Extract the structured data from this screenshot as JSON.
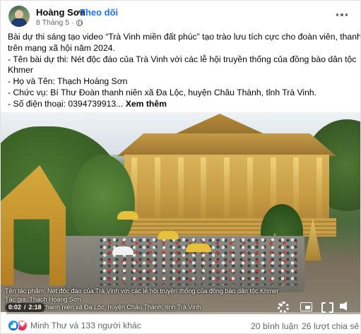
{
  "post": {
    "author": "Hoàng Sơn",
    "separator": "·",
    "follow_label": "Theo dõi",
    "date": "8 Tháng 5",
    "meta_separator": "·",
    "privacy_icon": "globe-icon",
    "more_icon": "more-options-icon",
    "text_lines": [
      "Bài dự thi sáng tạo video “Trà Vinh miền đất phúc” tạo trào lưu tích cực cho đoàn viên, thanh niên",
      "trên mạng xã hội năm 2024.",
      "- Tên bài dự thi: Nét độc đáo của Trà Vinh với các lễ hội truyền thống của đồng bào dân tộc",
      "Khmer",
      "- Họ và Tên: Thạch Hoàng Sơn",
      "- Chức vụ: Bí Thư Đoàn thanh niên xã Đa Lộc, huyện Châu Thành, tỉnh Trà Vinh.",
      "- Số điện thoại: 0394739913..."
    ],
    "see_more_label": "Xem thêm"
  },
  "video": {
    "caption_lines": [
      "Tên tác phẩm: Nét độc đáo của Trà Vinh với các lễ hội truyền thống của đồng bào dân tộc Khmer",
      "Tác giả: Thạch Hoàng Sơn",
      "Đơn vị: Đoàn thanh niên xã Đa Lộc, huyện Châu Thành, tỉnh Trà Vinh"
    ],
    "current_time": "0:02",
    "time_separator": "/",
    "duration": "2:18",
    "progress": 0.015,
    "controls": {
      "settings_icon": "gear-icon",
      "pip_icon": "picture-in-picture-icon",
      "fullscreen_icon": "fullscreen-icon",
      "volume_icon": "volume-icon"
    }
  },
  "footer": {
    "reactions_text": "Minh Thư và 133 người khác",
    "comments": "20 bình luận",
    "shares": "26 lượt chia sẻ",
    "like_icon": "like-icon",
    "heart_icon": "heart-icon"
  },
  "colors": {
    "link": "#1877f2",
    "secondary_text": "#65676b",
    "like_blue": "#0062df",
    "love_red": "#e61e4d"
  }
}
